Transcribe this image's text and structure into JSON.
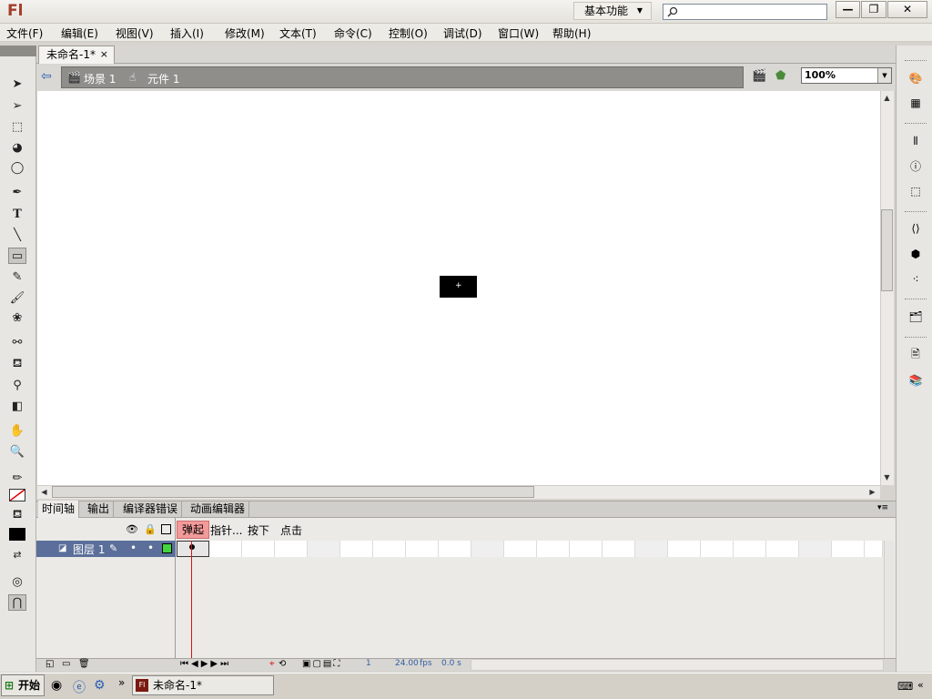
{
  "titlebar": {
    "logo": "Fl",
    "workspace": "基本功能",
    "search_placeholder": "",
    "minimize": "—",
    "restore": "❐",
    "close": "✕"
  },
  "menu": [
    "文件(F)",
    "编辑(E)",
    "视图(V)",
    "插入(I)",
    "修改(M)",
    "文本(T)",
    "命令(C)",
    "控制(O)",
    "调试(D)",
    "窗口(W)",
    "帮助(H)"
  ],
  "document": {
    "tab_label": "未命名-1*",
    "tab_close": "×",
    "scene": "场景 1",
    "symbol": "元件 1",
    "zoom": "100%"
  },
  "timeline": {
    "tabs": [
      "时间轴",
      "输出",
      "编译器错误",
      "动画编辑器"
    ],
    "frame_labels": [
      "弹起",
      "指针...",
      "按下",
      "点击"
    ],
    "layer_name": "图层 1",
    "current_frame": "1",
    "fps": "24.00",
    "fps_unit": "fps",
    "time": "0.0 s"
  },
  "taskbar": {
    "start": "开始",
    "task": "未命名-1*",
    "more": "»"
  },
  "colors": {
    "accent_label": "#f39a9a",
    "layer_selected": "#5b6f9a",
    "playhead": "#dd1111"
  }
}
